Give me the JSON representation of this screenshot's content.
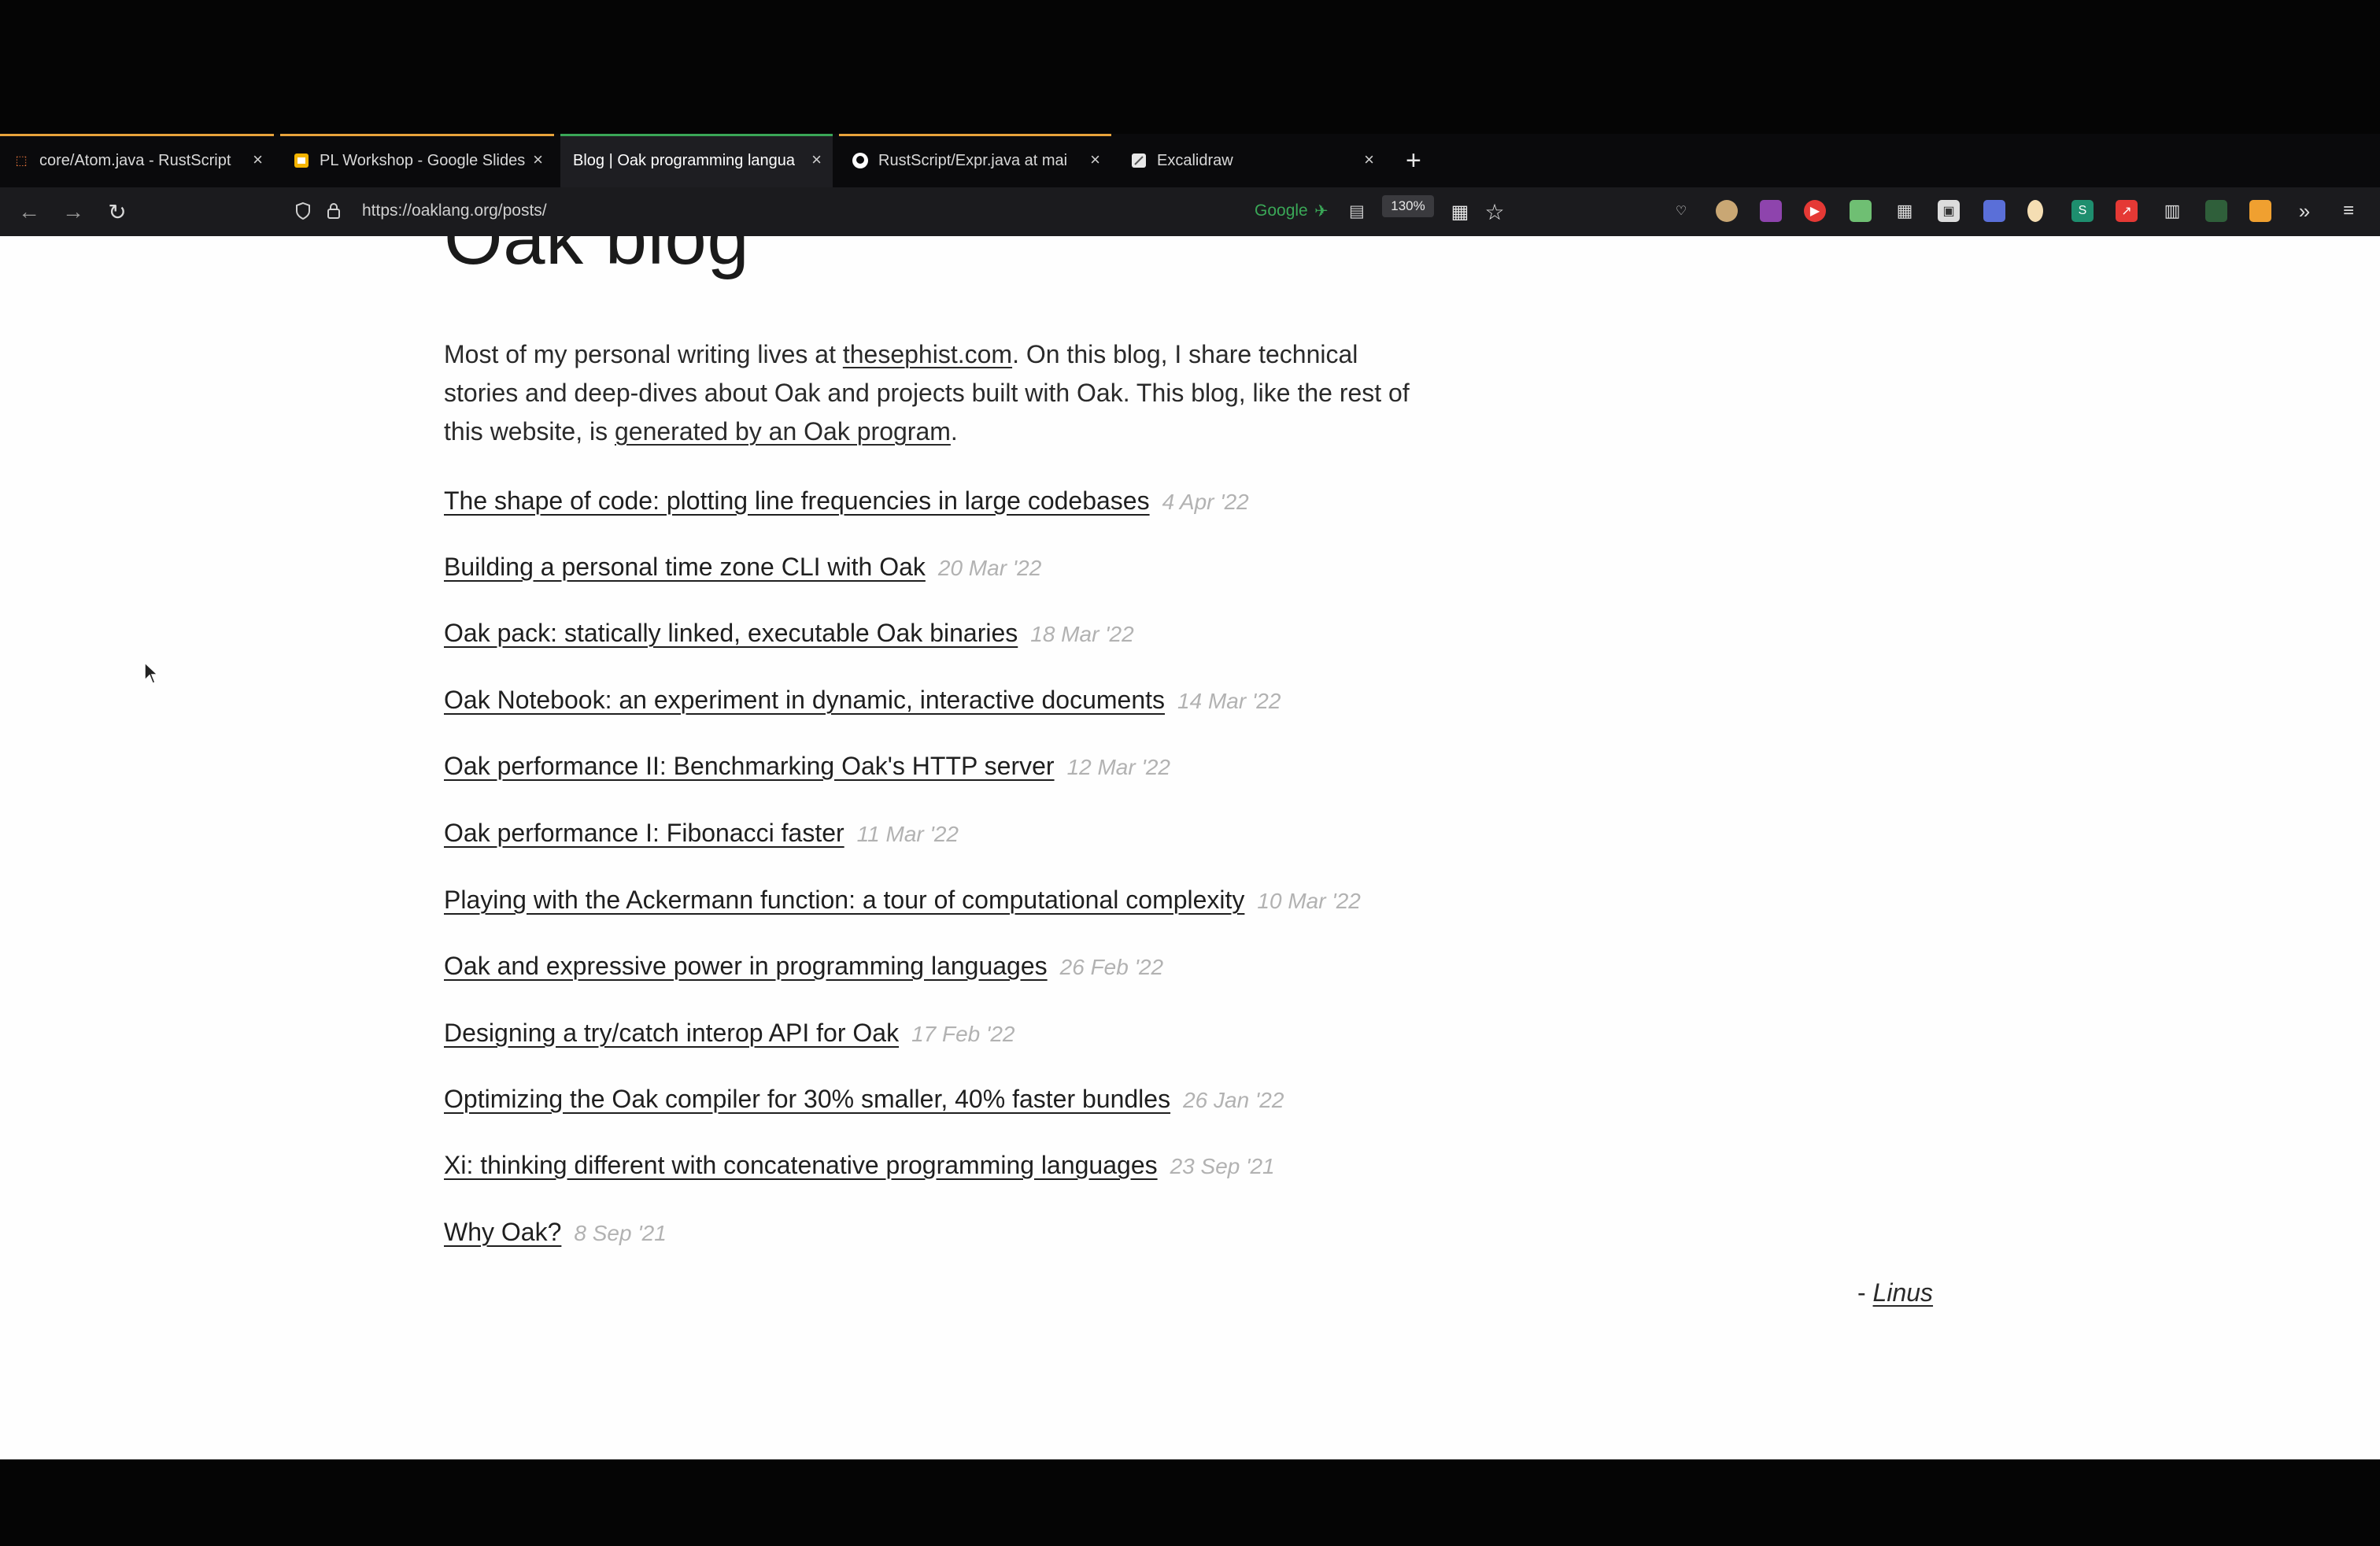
{
  "browser": {
    "tabs": [
      {
        "title": "core/Atom.java - RustScript",
        "close": "×",
        "favicon": "orange-source-icon"
      },
      {
        "title": "PL Workshop - Google Slides",
        "close": "×",
        "favicon": "slides-icon"
      },
      {
        "title": "Blog | Oak programming langua",
        "close": "×",
        "favicon": "none",
        "active": true
      },
      {
        "title": "RustScript/Expr.java at mai",
        "close": "×",
        "favicon": "github-icon"
      },
      {
        "title": "Excalidraw",
        "close": "×",
        "favicon": "excalidraw-icon"
      }
    ],
    "new_tab": "+",
    "url": "https://oaklang.org/posts/",
    "search_engine": "Google",
    "zoom": "130%"
  },
  "page": {
    "heading": "Oak blog",
    "intro": {
      "part1": "Most of my personal writing lives at ",
      "link1": "thesephist.com",
      "part2": ". On this blog, I share technical stories and deep-dives about Oak and projects built with Oak. This blog, like the rest of this website, is ",
      "link2": "generated by an Oak program",
      "part3": "."
    },
    "posts": [
      {
        "title": "The shape of code: plotting line frequencies in large codebases",
        "date": "4 Apr '22"
      },
      {
        "title": "Building a personal time zone CLI with Oak",
        "date": "20 Mar '22"
      },
      {
        "title": "Oak pack: statically linked, executable Oak binaries",
        "date": "18 Mar '22"
      },
      {
        "title": "Oak Notebook: an experiment in dynamic, interactive documents",
        "date": "14 Mar '22"
      },
      {
        "title": "Oak performance II: Benchmarking Oak's HTTP server",
        "date": "12 Mar '22"
      },
      {
        "title": "Oak performance I: Fibonacci faster",
        "date": "11 Mar '22"
      },
      {
        "title": "Playing with the Ackermann function: a tour of computational complexity",
        "date": "10 Mar '22"
      },
      {
        "title": "Oak and expressive power in programming languages",
        "date": "26 Feb '22"
      },
      {
        "title": "Designing a try/catch interop API for Oak",
        "date": "17 Feb '22"
      },
      {
        "title": "Optimizing the Oak compiler for 30% smaller, 40% faster bundles",
        "date": "26 Jan '22"
      },
      {
        "title": "Xi: thinking different with concatenative programming languages",
        "date": "23 Sep '21"
      },
      {
        "title": "Why Oak?",
        "date": "8 Sep '21"
      }
    ],
    "signature": {
      "prefix": "- ",
      "name": "Linus"
    }
  },
  "colors": {
    "tab_accent": "#e8a33b",
    "tab_accent_green": "#3aa757",
    "page_bg": "#fefefe"
  }
}
